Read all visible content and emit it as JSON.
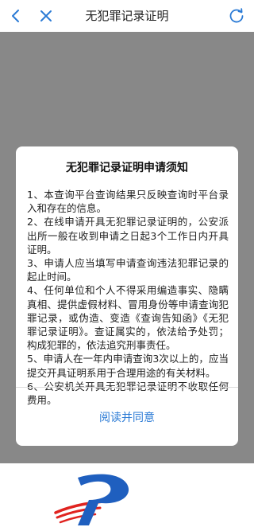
{
  "header": {
    "title": "无犯罪记录证明",
    "back_icon": "chevron-left-icon",
    "close_icon": "close-icon",
    "refresh_icon": "refresh-icon"
  },
  "dialog": {
    "title": "无犯罪记录证明申请须知",
    "items": [
      "1、本查询平台查询结果只反映查询时平台录入和存在的信息。",
      "2、在线申请开具无犯罪记录证明的，公安派出所一般在收到申请之日起3个工作日内开具证明。",
      "3、申请人应当填写申请查询违法犯罪记录的起止时间。",
      "4、任何单位和个人不得采用编造事实、隐瞒真相、提供虚假材料、冒用身份等申请查询犯罪记录，或伪造、变造《查询告知函》《无犯罪记录证明》。查证属实的，依法给予处罚；构成犯罪的，依法追究刑事责任。",
      "5、申请人在一年内申请查询3次以上的，应当提交开具证明系用于合理用途的有关材料。",
      "6、公安机关开具无犯罪记录证明不收取任何费用。"
    ],
    "confirm_label": "阅读并同意"
  },
  "colors": {
    "accent": "#2a7ad5",
    "overlay": "#888888",
    "logo_blue": "#1f5fbf",
    "logo_red": "#e0231f"
  }
}
